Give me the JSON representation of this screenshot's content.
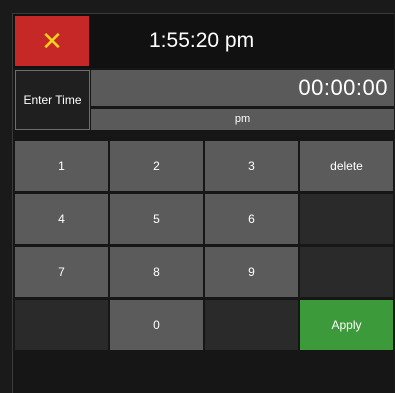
{
  "header": {
    "close_glyph": "✕",
    "clock_text": "1:55:20 pm"
  },
  "entry": {
    "label": "Enter Time",
    "time_value": "00:00:00",
    "ampm_value": "pm"
  },
  "keypad": {
    "keys": [
      {
        "label": "1"
      },
      {
        "label": "2"
      },
      {
        "label": "3"
      },
      {
        "label": "delete"
      },
      {
        "label": "4"
      },
      {
        "label": "5"
      },
      {
        "label": "6"
      },
      {
        "label": ""
      },
      {
        "label": "7"
      },
      {
        "label": "8"
      },
      {
        "label": "9"
      },
      {
        "label": ""
      },
      {
        "label": ""
      },
      {
        "label": "0"
      },
      {
        "label": ""
      },
      {
        "label": "Apply"
      }
    ]
  },
  "colors": {
    "close_bg": "#c62828",
    "close_glyph": "#f7d21b",
    "apply_bg": "#3d9a3a",
    "key_bg": "#5b5b5b",
    "field_bg": "#5a5a5a"
  },
  "icons": {
    "close": "close-icon"
  }
}
